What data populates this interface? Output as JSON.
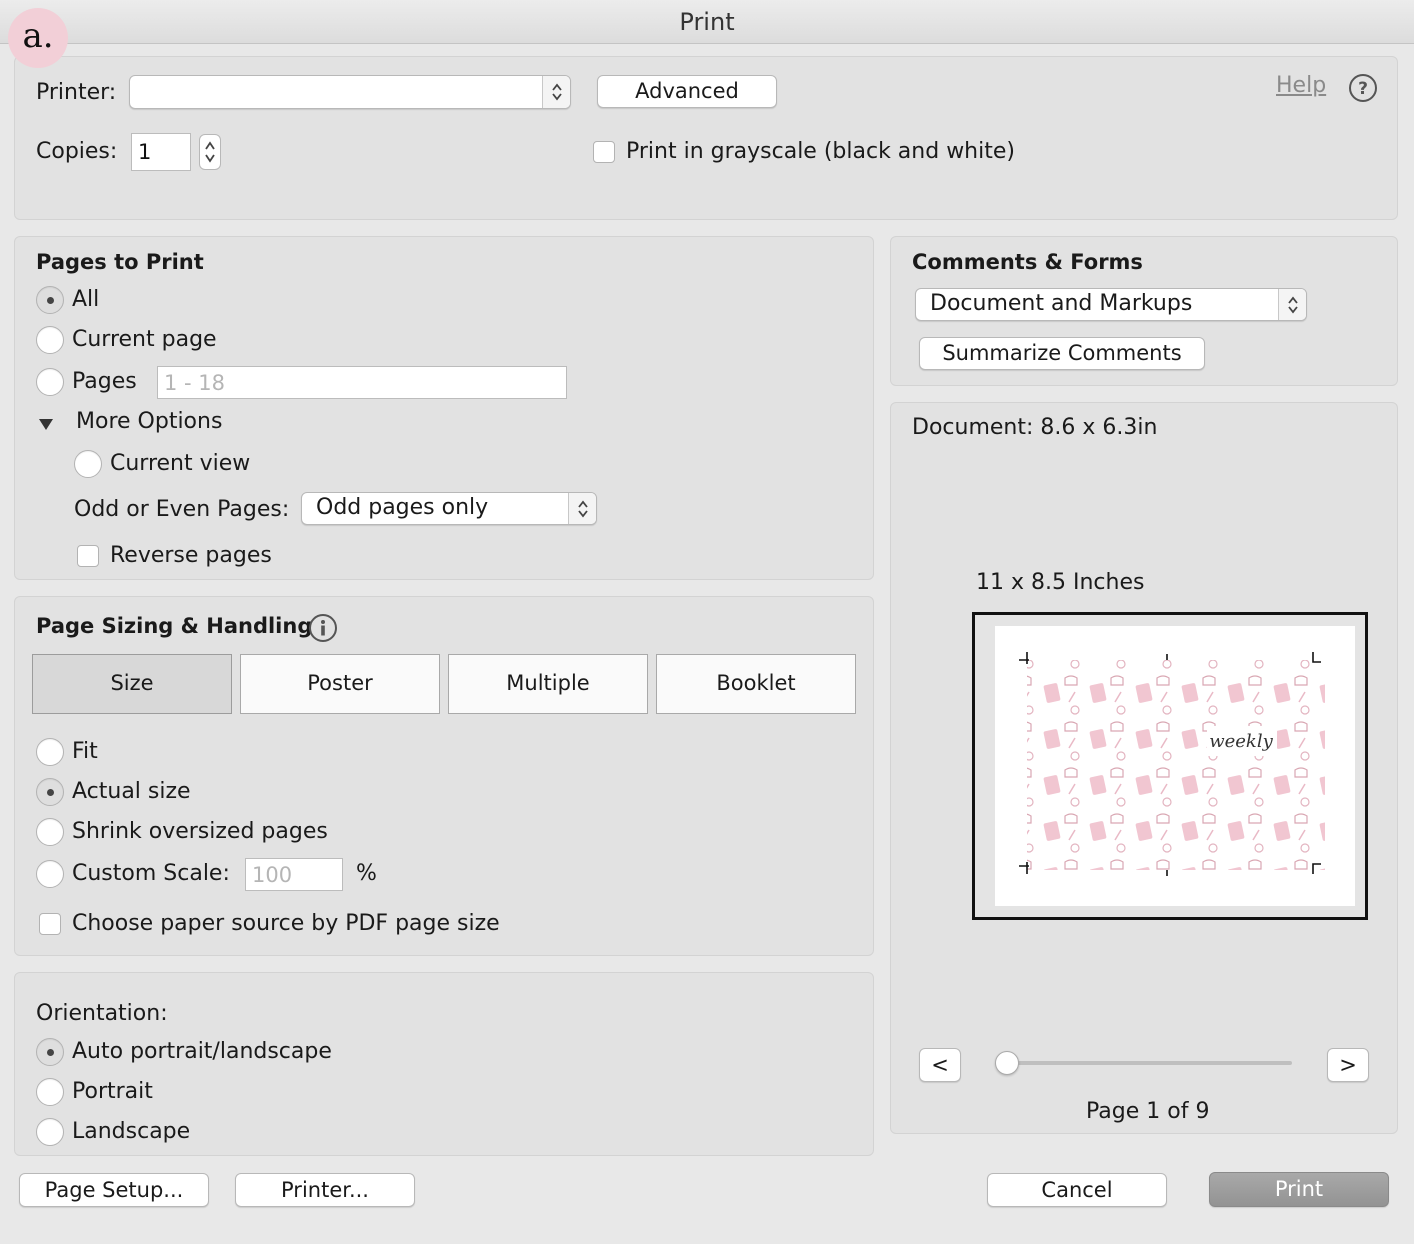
{
  "window": {
    "title": "Print"
  },
  "badge": "a.",
  "printer": {
    "label": "Printer:",
    "value": "",
    "advanced_label": "Advanced",
    "help_label": "Help",
    "copies_label": "Copies:",
    "copies_value": "1",
    "grayscale_label": "Print in grayscale (black and white)",
    "grayscale_checked": false
  },
  "pages_to_print": {
    "heading": "Pages to Print",
    "all_label": "All",
    "current_page_label": "Current page",
    "pages_label": "Pages",
    "pages_placeholder": "1 - 18",
    "more_options_label": "More Options",
    "current_view_label": "Current view",
    "odd_even_label": "Odd or Even Pages:",
    "odd_even_value": "Odd pages only",
    "reverse_label": "Reverse pages",
    "selected": "all"
  },
  "page_sizing": {
    "heading": "Page Sizing & Handling",
    "tabs": [
      "Size",
      "Poster",
      "Multiple",
      "Booklet"
    ],
    "active_tab": "Size",
    "fit_label": "Fit",
    "actual_size_label": "Actual size",
    "shrink_label": "Shrink oversized pages",
    "custom_scale_label": "Custom Scale:",
    "custom_scale_value": "100",
    "percent_label": "%",
    "paper_source_label": "Choose paper source by PDF page size",
    "selected": "actual_size"
  },
  "orientation": {
    "heading": "Orientation:",
    "auto_label": "Auto portrait/landscape",
    "portrait_label": "Portrait",
    "landscape_label": "Landscape",
    "selected": "auto"
  },
  "comments_forms": {
    "heading": "Comments & Forms",
    "value": "Document and Markups",
    "summarize_label": "Summarize Comments"
  },
  "preview": {
    "document_label": "Document: 8.6 x 6.3in",
    "paper_label": "11 x 8.5 Inches",
    "prev_label": "<",
    "next_label": ">",
    "page_label": "Page 1 of 9",
    "preview_text": "weekly",
    "slider_position": 0
  },
  "footer": {
    "page_setup_label": "Page Setup...",
    "printer_label": "Printer...",
    "cancel_label": "Cancel",
    "print_label": "Print"
  },
  "colors": {
    "pattern_pink": "#f1c6d1",
    "pattern_pink_dark": "#e5a9b8",
    "print_button": "#9e9e9e"
  }
}
